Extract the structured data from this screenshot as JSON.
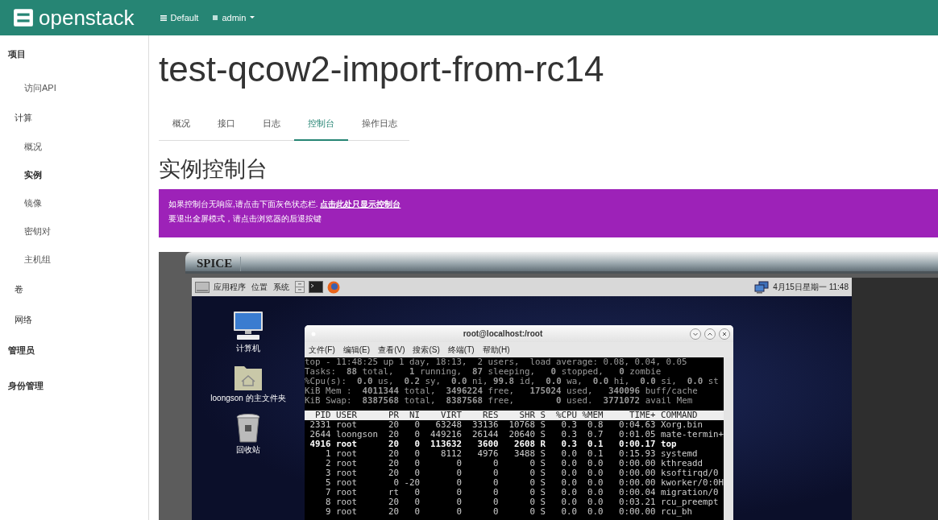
{
  "header": {
    "brand": "openstack",
    "domain": "Default",
    "user": "admin"
  },
  "sidebar": {
    "items": [
      {
        "label": "项目",
        "kind": "group",
        "children": [
          {
            "label": "访问API",
            "kind": "link",
            "selected": false
          },
          {
            "label": "计算",
            "kind": "group",
            "children": [
              {
                "label": "概况",
                "kind": "link",
                "selected": false
              },
              {
                "label": "实例",
                "kind": "link",
                "selected": true
              },
              {
                "label": "镜像",
                "kind": "link",
                "selected": false
              },
              {
                "label": "密钥对",
                "kind": "link",
                "selected": false
              },
              {
                "label": "主机组",
                "kind": "link",
                "selected": false
              }
            ]
          },
          {
            "label": "卷",
            "kind": "group"
          },
          {
            "label": "网络",
            "kind": "group"
          }
        ]
      },
      {
        "label": "管理员",
        "kind": "group"
      },
      {
        "label": "身份管理",
        "kind": "group"
      }
    ]
  },
  "page_title": "test-qcow2-import-from-rc14",
  "tabs": [
    {
      "label": "概况",
      "selected": false
    },
    {
      "label": "接口",
      "selected": false
    },
    {
      "label": "日志",
      "selected": false
    },
    {
      "label": "控制台",
      "selected": true
    },
    {
      "label": "操作日志",
      "selected": false
    }
  ],
  "section_title": "实例控制台",
  "alert": {
    "text": "如果控制台无响应,请点击下面灰色状态栏.",
    "link": "点击此处只显示控制台",
    "line2": "要退出全屏模式，请点击浏览器的后退按键"
  },
  "console": {
    "tab": "SPICE",
    "panel": {
      "menus": [
        "应用程序",
        "位置",
        "系统"
      ],
      "clock": "4月15日星期一 11:48"
    },
    "desktop_icons": [
      {
        "kind": "computer",
        "label": "计算机"
      },
      {
        "kind": "home",
        "label": "loongson 的主文件夹"
      },
      {
        "kind": "trash",
        "label": "回收站"
      }
    ],
    "terminal": {
      "title": "root@localhost:/root",
      "menus": [
        "文件(F)",
        "编辑(E)",
        "查看(V)",
        "搜索(S)",
        "终端(T)",
        "帮助(H)"
      ],
      "summary": [
        "top - 11:48:25 up 1 day, 18:13,  2 users,  load average: 0.08, 0.04, 0.05",
        "Tasks:  **88** total,   **1** running,  **87** sleeping,   **0** stopped,   **0** zombie",
        "%Cpu(s):  **0.0** us,  **0.2** sy,  **0.0** ni, **99.8** id,  **0.0** wa,  **0.0** hi,  **0.0** si,  **0.0** st",
        "KiB Mem :  **4011344** total,  **3496224** free,   **175024** used,   **340096** buff/cache",
        "KiB Swap:  **8387568** total,  **8387568** free,        **0** used.  **3771072** avail Mem"
      ],
      "columns": "  PID USER      PR  NI    VIRT    RES    SHR S  %CPU %MEM     TIME+ COMMAND",
      "processes": [
        {
          "line": " 2331 root      20   0   63248  33136  10768 S   0.3  0.8   0:04.63 Xorg.bin",
          "selected": false
        },
        {
          "line": " 2644 loongson  20   0  449216  26144  20640 S   0.3  0.7   0:01.05 mate-termin+",
          "selected": false
        },
        {
          "line": " 4916 root      20   0  113632   3600   2608 R   0.3  0.1   0:00.17 top",
          "selected": true
        },
        {
          "line": "    1 root      20   0    8112   4976   3488 S   0.0  0.1   0:15.93 systemd",
          "selected": false
        },
        {
          "line": "    2 root      20   0       0      0      0 S   0.0  0.0   0:00.00 kthreadd",
          "selected": false
        },
        {
          "line": "    3 root      20   0       0      0      0 S   0.0  0.0   0:00.00 ksoftirqd/0",
          "selected": false
        },
        {
          "line": "    5 root       0 -20       0      0      0 S   0.0  0.0   0:00.00 kworker/0:0H",
          "selected": false
        },
        {
          "line": "    7 root      rt   0       0      0      0 S   0.0  0.0   0:00.04 migration/0",
          "selected": false
        },
        {
          "line": "    8 root      20   0       0      0      0 S   0.0  0.0   0:03.21 rcu_preempt",
          "selected": false
        },
        {
          "line": "    9 root      20   0       0      0      0 S   0.0  0.0   0:00.00 rcu_bh",
          "selected": false
        }
      ]
    }
  }
}
